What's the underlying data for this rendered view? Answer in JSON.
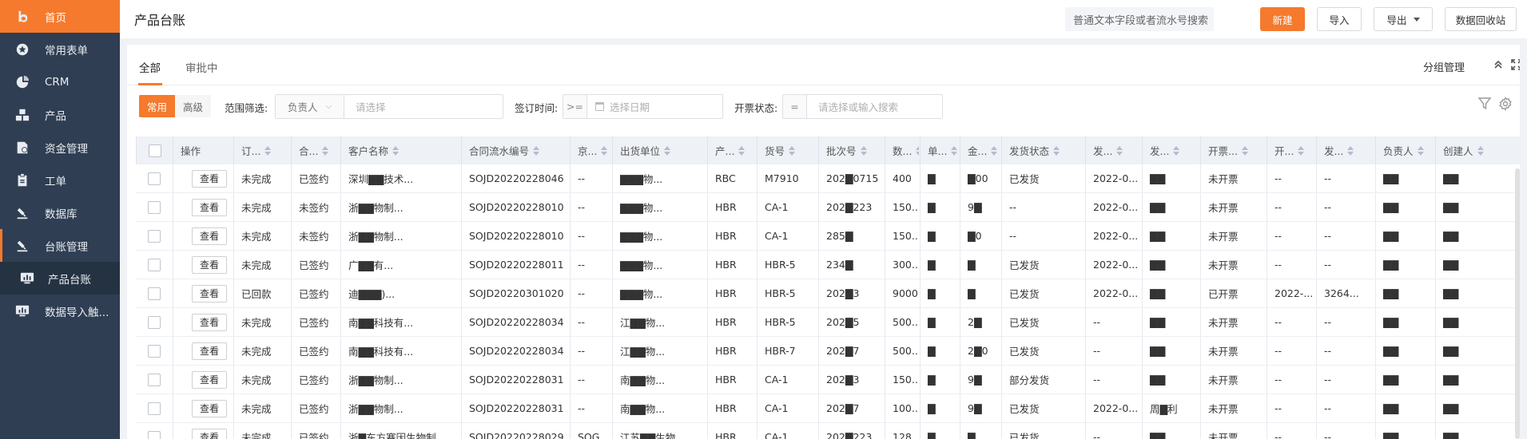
{
  "sidebar": {
    "logo_label": "首页",
    "items": [
      {
        "label": "常用表单",
        "icon": "star-circle-icon"
      },
      {
        "label": "CRM",
        "icon": "pie-icon"
      },
      {
        "label": "产品",
        "icon": "boxes-icon"
      },
      {
        "label": "资金管理",
        "icon": "money-doc-icon"
      },
      {
        "label": "工单",
        "icon": "clipboard-icon"
      },
      {
        "label": "数据库",
        "icon": "database-icon"
      },
      {
        "label": "台账管理",
        "icon": "ledger-icon"
      },
      {
        "label": "产品台账",
        "icon": "chart-board-icon"
      },
      {
        "label": "数据导入触...",
        "icon": "monitor-chart-icon"
      }
    ]
  },
  "header": {
    "title": "产品台账",
    "search_text": "普通文本字段或者流水号搜索",
    "new_label": "新建",
    "import_label": "导入",
    "export_label": "导出",
    "recycle_label": "数据回收站"
  },
  "tabs": {
    "all": "全部",
    "pending": "审批中",
    "group_mgmt": "分组管理"
  },
  "filters": {
    "common": "常用",
    "advanced": "高级",
    "scope_label": "范围筛选:",
    "owner": "负责人",
    "owner_placeholder": "请选择",
    "sign_label": "签订时间:",
    "sign_op": ">=",
    "sign_placeholder": "选择日期",
    "invoice_label": "开票状态:",
    "invoice_op": "=",
    "invoice_placeholder": "请选择或输入搜索"
  },
  "table": {
    "columns": [
      "操作",
      "订...",
      "合...",
      "客户名称",
      "合同流水编号",
      "京...",
      "出货单位",
      "产...",
      "货号",
      "批次号",
      "数...",
      "单...",
      "金...",
      "发货状态",
      "发...",
      "发...",
      "开票...",
      "开...",
      "发...",
      "负责人",
      "创建人"
    ],
    "view_label": "查看",
    "rows": [
      [
        "未完成",
        "已签约",
        "深圳▇▇技术...",
        "SOJD20220228046",
        "--",
        "▇▇▇物...",
        "RBC",
        "M7910",
        "202▇0715",
        "400",
        "▇",
        "▇00",
        "已发货",
        "2022-0...",
        "▇▇",
        "未开票",
        "--",
        "--",
        "▇▇",
        "▇▇"
      ],
      [
        "未完成",
        "未签约",
        "浙▇▇物制...",
        "SOJD20220228010",
        "--",
        "▇▇▇物...",
        "HBR",
        "CA-1",
        "202▇223",
        "150...",
        "▇",
        "9▇",
        "--",
        "2022-0...",
        "▇▇",
        "未开票",
        "--",
        "--",
        "▇▇",
        "▇▇"
      ],
      [
        "未完成",
        "未签约",
        "浙▇▇物制...",
        "SOJD20220228010",
        "--",
        "▇▇▇物...",
        "HBR",
        "CA-1",
        "285▇",
        "150...",
        "▇",
        "▇0",
        "--",
        "2022-0...",
        "▇▇",
        "未开票",
        "--",
        "--",
        "▇▇",
        "▇▇"
      ],
      [
        "未完成",
        "已签约",
        "广▇▇有...",
        "SOJD20220228011",
        "--",
        "▇▇▇物...",
        "HBR",
        "HBR-5",
        "234▇",
        "300...",
        "▇",
        "▇",
        "已发货",
        "2022-0...",
        "▇▇",
        "未开票",
        "--",
        "--",
        "▇▇",
        "▇▇"
      ],
      [
        "已回款",
        "已签约",
        "迪▇▇▇)...",
        "SOJD20220301020",
        "--",
        "▇▇▇物...",
        "HBR",
        "HBR-5",
        "202▇3",
        "9000",
        "▇",
        "▇",
        "已发货",
        "2022-0...",
        "▇▇",
        "已开票",
        "2022-...",
        "3264...",
        "▇▇",
        "▇▇"
      ],
      [
        "未完成",
        "已签约",
        "南▇▇科技有...",
        "SOJD20220228034",
        "--",
        "江▇▇物...",
        "HBR",
        "HBR-5",
        "202▇5",
        "500...",
        "▇",
        "2▇",
        "已发货",
        "--",
        "▇▇",
        "未开票",
        "--",
        "--",
        "▇▇",
        "▇▇"
      ],
      [
        "未完成",
        "已签约",
        "南▇▇科技有...",
        "SOJD20220228034",
        "--",
        "江▇▇物...",
        "HBR",
        "HBR-7",
        "202▇7",
        "500...",
        "▇",
        "2▇0",
        "已发货",
        "--",
        "▇▇",
        "未开票",
        "--",
        "--",
        "▇▇",
        "▇▇"
      ],
      [
        "未完成",
        "已签约",
        "浙▇▇物制...",
        "SOJD20220228031",
        "--",
        "南▇▇物...",
        "HBR",
        "CA-1",
        "202▇3",
        "150...",
        "▇",
        "9▇",
        "部分发货",
        "--",
        "▇▇",
        "未开票",
        "--",
        "--",
        "▇▇",
        "▇▇"
      ],
      [
        "未完成",
        "已签约",
        "浙▇▇物制...",
        "SOJD20220228031",
        "--",
        "南▇▇物...",
        "HBR",
        "CA-1",
        "202▇7",
        "100...",
        "▇",
        "9▇",
        "已发货",
        "2022-0...",
        "周▇利",
        "未开票",
        "--",
        "--",
        "▇▇",
        "▇▇"
      ],
      [
        "未完成",
        "已签约",
        "浙▇东方赛因生物制...",
        "SOJD20220228029",
        "SOG",
        "江苏▇▇生物...",
        "HBR",
        "CA-1",
        "202▇223",
        "128...",
        "▇",
        "▇",
        "已发货",
        "--",
        "▇▇",
        "未开票",
        "--",
        "--",
        "▇▇",
        "▇▇"
      ]
    ]
  },
  "colors": {
    "accent": "#f57a2d",
    "sidebar": "#2f3e52"
  }
}
